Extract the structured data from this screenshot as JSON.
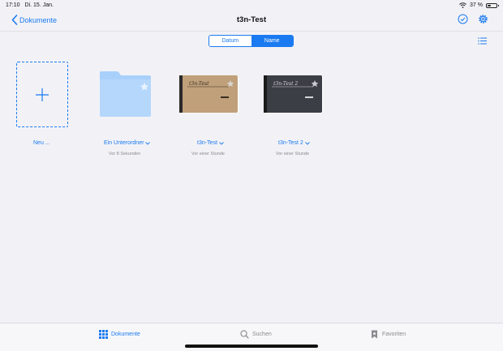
{
  "status": {
    "time": "17:10",
    "date": "Di. 15. Jan.",
    "battery_text": "37 %",
    "battery_level": 0.37
  },
  "nav": {
    "back_label": "Dokumente",
    "title": "t3n-Test"
  },
  "sort": {
    "options": [
      "Datum",
      "Name"
    ],
    "selected": "Name"
  },
  "items": [
    {
      "label": "Neu ...",
      "sub": "",
      "type": "new"
    },
    {
      "label": "Ein Unterordner",
      "sub": "Vor 8 Sekunden",
      "type": "folder"
    },
    {
      "label": "t3n-Test",
      "sub": "Vor einer Stunde",
      "type": "notebook-brown",
      "cover_title": "t3n-Test"
    },
    {
      "label": "t3n-Test 2",
      "sub": "Vor einer Stunde",
      "type": "notebook-dark",
      "cover_title": "t3n-Test 2"
    }
  ],
  "tabs": [
    {
      "label": "Dokumente",
      "icon": "grid-icon",
      "active": true
    },
    {
      "label": "Suchen",
      "icon": "search-icon",
      "active": false
    },
    {
      "label": "Favoriten",
      "icon": "bookmark-icon",
      "active": false
    }
  ],
  "colors": {
    "accent": "#1a7af1",
    "background": "#f2f2f6",
    "folder": "#a9d0fb"
  }
}
